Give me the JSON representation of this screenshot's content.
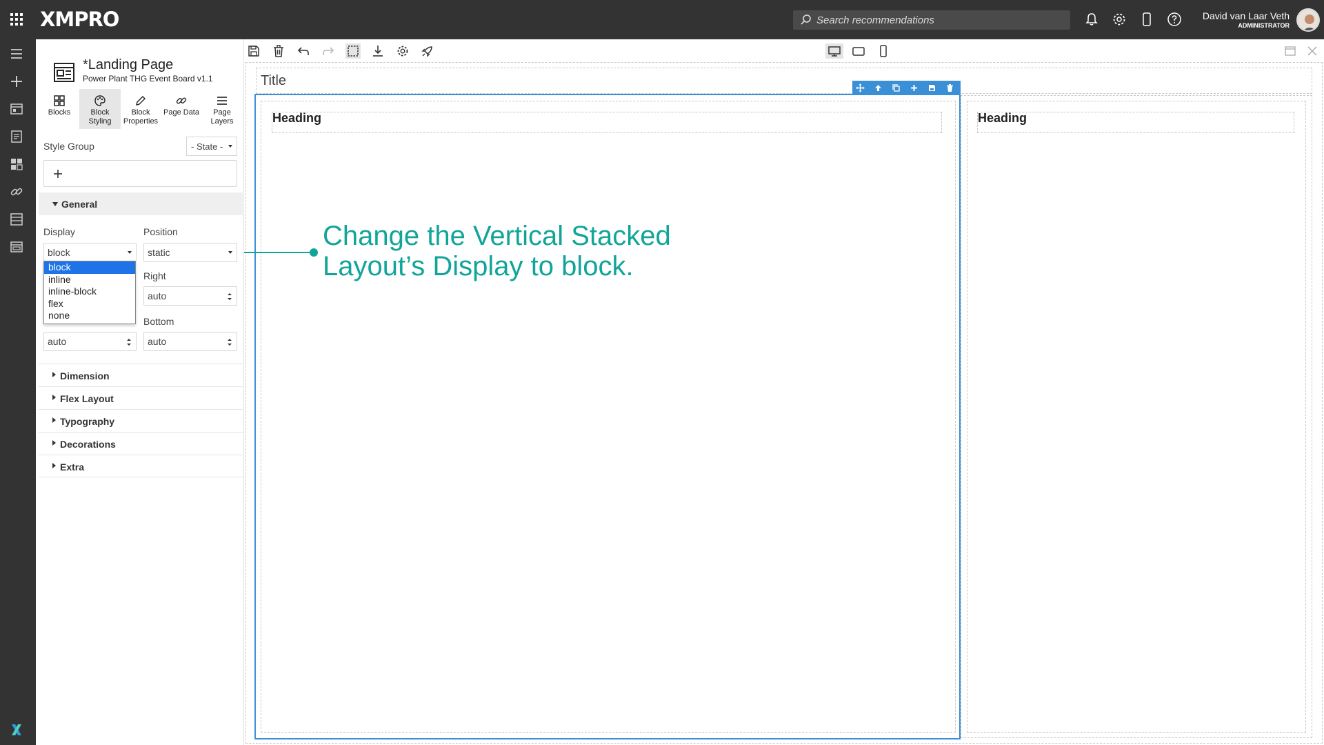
{
  "topbar": {
    "logo": "XMPRO",
    "search_placeholder": "Search recommendations",
    "user_name": "David van Laar Veth",
    "user_role": "ADMINISTRATOR"
  },
  "panel": {
    "page_title": "*Landing Page",
    "page_subtitle": "Power Plant THG Event Board v1.1",
    "tabs": [
      {
        "line1": "Blocks",
        "line2": ""
      },
      {
        "line1": "Block",
        "line2": "Styling"
      },
      {
        "line1": "Block",
        "line2": "Properties"
      },
      {
        "line1": "Page Data",
        "line2": ""
      },
      {
        "line1": "Page",
        "line2": "Layers"
      }
    ],
    "style_group_label": "Style Group",
    "state_value": "- State -",
    "general": {
      "title": "General",
      "display_label": "Display",
      "display_value": "block",
      "position_label": "Position",
      "position_value": "static",
      "right_label": "Right",
      "right_value": "auto",
      "bottom_label": "Bottom",
      "bottom_value": "auto",
      "left_value": "auto"
    },
    "display_options": [
      "block",
      "inline",
      "inline-block",
      "flex",
      "none"
    ],
    "sections": [
      "Dimension",
      "Flex Layout",
      "Typography",
      "Decorations",
      "Extra"
    ]
  },
  "canvas": {
    "title": "Title",
    "heading_left": "Heading",
    "heading_right": "Heading"
  },
  "callout": {
    "line1": "Change the Vertical Stacked",
    "line2": "Layout’s Display to block."
  },
  "colors": {
    "topbar": "#333333",
    "accent": "#3a8fd6",
    "callout": "#11a59a",
    "dropdown_selected": "#1e73e8"
  }
}
